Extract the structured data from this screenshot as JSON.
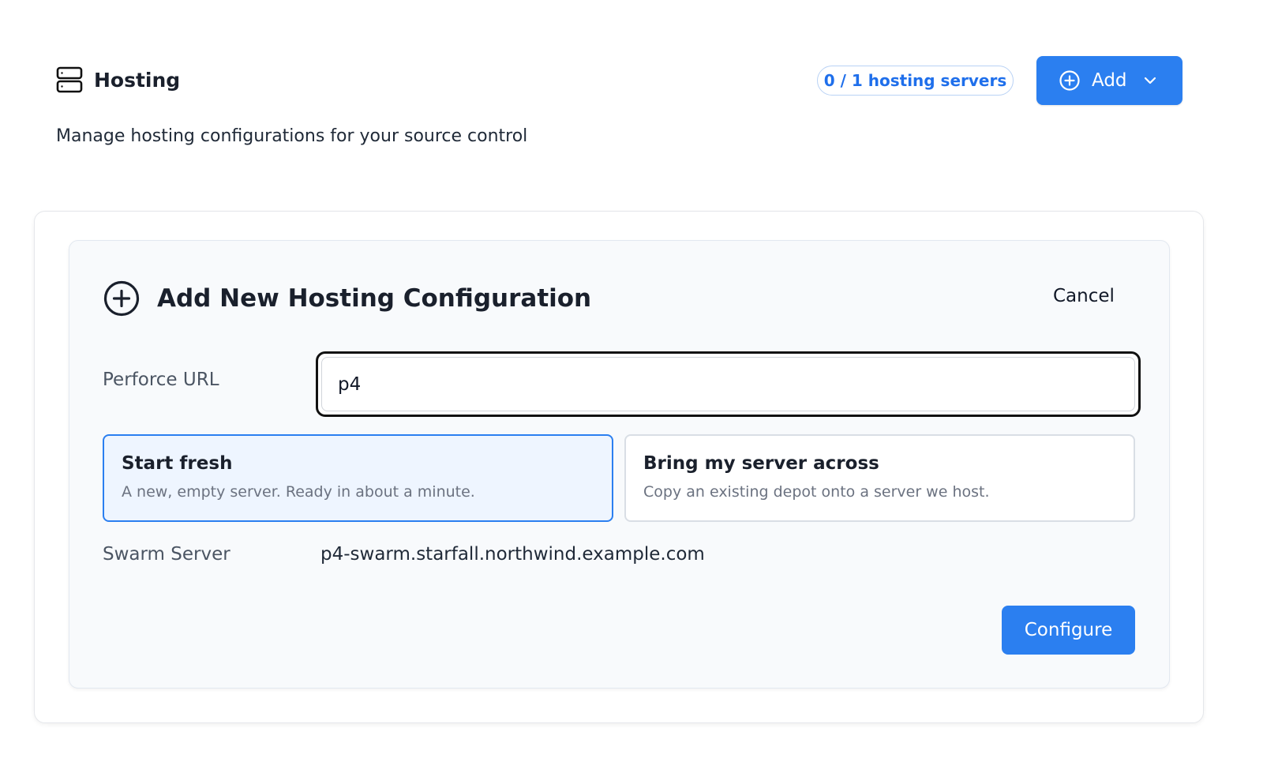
{
  "header": {
    "title": "Hosting",
    "icon": "server-icon",
    "badge": "0 / 1 hosting servers",
    "add_button": {
      "label": "Add",
      "icon": "plus-circle-icon",
      "caret": "chevron-down-icon"
    }
  },
  "subtitle": "Manage hosting configurations for your source control",
  "form": {
    "title": "Add New Hosting Configuration",
    "title_icon": "plus-circle-icon",
    "cancel_label": "Cancel",
    "perforce_url": {
      "label": "Perforce URL",
      "value": "p4"
    },
    "options": [
      {
        "title": "Start fresh",
        "description": "A new, empty server. Ready in about a minute.",
        "selected": true
      },
      {
        "title": "Bring my server across",
        "description": "Copy an existing depot onto a server we host.",
        "selected": false
      }
    ],
    "swarm_server": {
      "label": "Swarm Server",
      "value": "p4-swarm.starfall.northwind.example.com"
    },
    "configure_label": "Configure"
  },
  "colors": {
    "accent": "#2b7ff0",
    "badge_text": "#1f6feb",
    "selected_bg": "#eef5ff",
    "panel_bg": "#f8fafc"
  }
}
